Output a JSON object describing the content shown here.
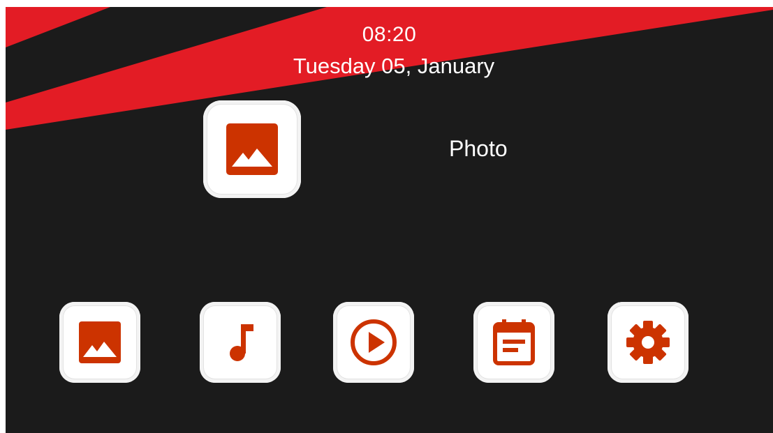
{
  "header": {
    "time": "08:20",
    "date": "Tuesday 05, January"
  },
  "focused_app": {
    "label": "Photo",
    "icon": "photo-icon"
  },
  "dock": [
    {
      "icon": "photo-icon"
    },
    {
      "icon": "music-icon"
    },
    {
      "icon": "video-play-icon"
    },
    {
      "icon": "calendar-icon"
    },
    {
      "icon": "settings-gear-icon"
    }
  ],
  "colors": {
    "background": "#1b1b1b",
    "accent_red": "#e31c25",
    "icon_red": "#cc3300",
    "tile_white": "#ffffff",
    "text": "#ffffff"
  }
}
